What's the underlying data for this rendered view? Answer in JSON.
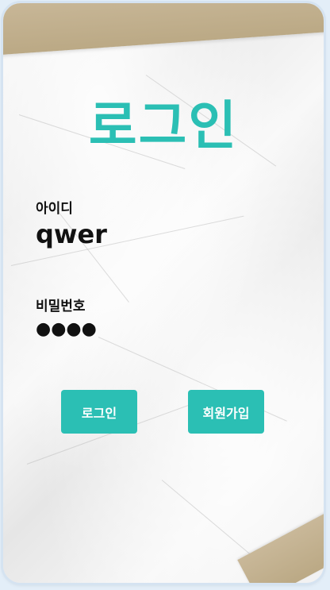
{
  "page": {
    "title": "로그인"
  },
  "form": {
    "id_label": "아이디",
    "id_value": "qwer",
    "password_label": "비밀번호",
    "password_value": "●●●●"
  },
  "buttons": {
    "login_label": "로그인",
    "signup_label": "회원가입"
  },
  "colors": {
    "accent": "#2bbfb4",
    "tape": "#c9b899"
  }
}
